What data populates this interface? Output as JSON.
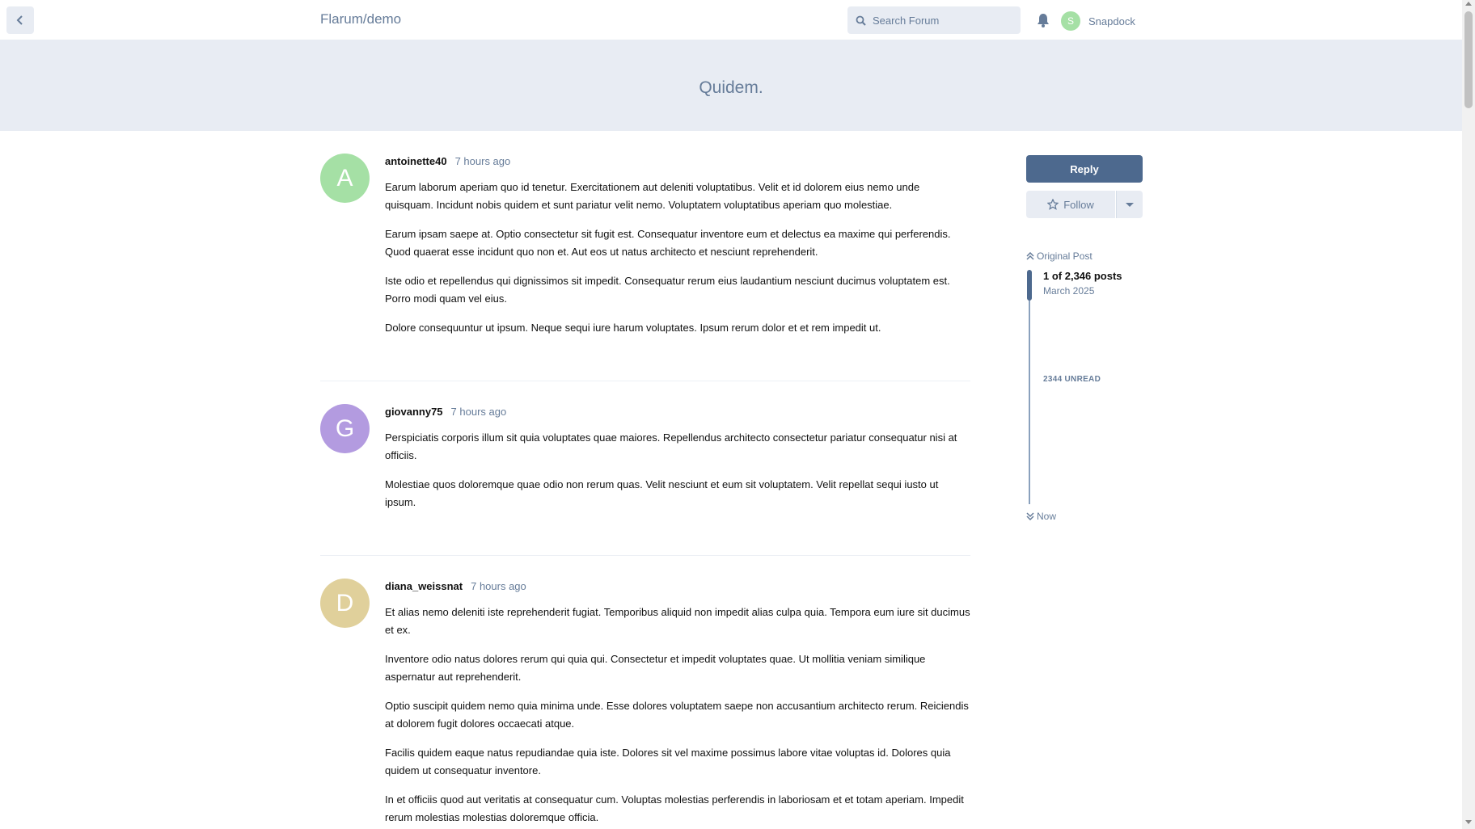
{
  "header": {
    "site_title": "Flarum/demo",
    "search_placeholder": "Search Forum",
    "user_initial": "S",
    "user_name": "Snapdock"
  },
  "discussion": {
    "title": "Quidem."
  },
  "posts": [
    {
      "initial": "A",
      "avatar_color": "#a5e0a5",
      "username": "antoinette40",
      "time": "7 hours ago",
      "paragraphs": [
        "Earum laborum aperiam quo id tenetur. Exercitationem aut deleniti voluptatibus. Velit et id dolorem eius nemo unde quisquam. Incidunt nobis quidem et sunt pariatur velit nemo. Voluptatem voluptatibus aperiam quo molestiae.",
        "Earum ipsam saepe at. Optio consectetur sit fugit est. Consequatur inventore eum et delectus ea maxime qui perferendis. Quod quaerat esse incidunt quo non et. Aut eos ut natus architecto et nesciunt reprehenderit.",
        "Iste odio et repellendus qui dignissimos sit impedit. Consequatur rerum eius laudantium nesciunt ducimus voluptatem est. Porro modi quam vel eius.",
        "Dolore consequuntur ut ipsum. Neque sequi iure harum voluptates. Ipsum rerum dolor et et rem impedit ut."
      ]
    },
    {
      "initial": "G",
      "avatar_color": "#b39be0",
      "username": "giovanny75",
      "time": "7 hours ago",
      "paragraphs": [
        "Perspiciatis corporis illum sit quia voluptates quae maiores. Repellendus architecto consectetur pariatur consequatur nisi at officiis.",
        "Molestiae quos doloremque quae odio non rerum quas. Velit nesciunt et eum sit voluptatem. Velit repellat sequi iusto ut ipsum."
      ]
    },
    {
      "initial": "D",
      "avatar_color": "#e0d09b",
      "username": "diana_weissnat",
      "time": "7 hours ago",
      "paragraphs": [
        "Et alias nemo deleniti iste reprehenderit fugiat. Temporibus aliquid non impedit alias culpa quia. Tempora eum iure sit ducimus et ex.",
        "Inventore odio natus dolores rerum qui quia qui. Consectetur et impedit voluptates quae. Ut mollitia veniam similique aspernatur aut reprehenderit.",
        "Optio suscipit quidem nemo quia minima unde. Esse dolores voluptatem saepe non accusantium architecto rerum. Reiciendis at dolorem fugit dolores occaecati atque.",
        "Facilis quidem eaque natus repudiandae quia iste. Dolores sit vel maxime possimus labore vitae voluptas id. Dolores quia quidem ut consequatur inventore.",
        "In et officiis quod aut veritatis at consequatur cum. Voluptas molestias perferendis in laboriosam et et totam aperiam. Impedit rerum molestias molestias doloremque officia."
      ]
    }
  ],
  "sidebar": {
    "reply_label": "Reply",
    "follow_label": "Follow",
    "scrubber": {
      "original_post_label": "Original Post",
      "count_text": "1 of 2,346 posts",
      "date_text": "March 2025",
      "unread_text": "2344 UNREAD",
      "now_label": "Now"
    }
  },
  "colors": {
    "accent": "#4d698e",
    "muted_text": "#667c99",
    "header_bg": "#e8ecf3"
  }
}
